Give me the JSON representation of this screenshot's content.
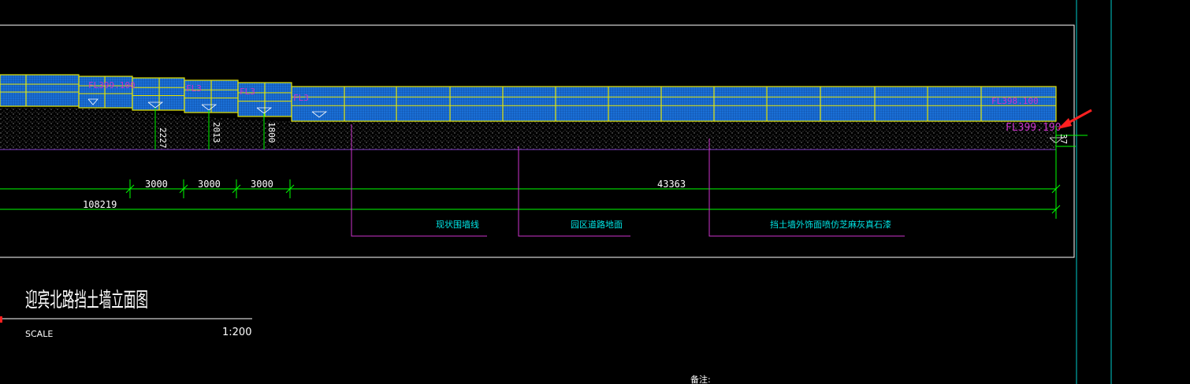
{
  "drawing": {
    "title": "迎宾北路挡土墙立面图",
    "scale_label": "SCALE",
    "scale_value": "1:200",
    "notes_label": "备注:"
  },
  "dimensions": {
    "segment_1": "3000",
    "segment_2": "3000",
    "segment_3": "3000",
    "main_span": "43363",
    "total_span": "108219",
    "height_1": "2227",
    "height_2": "2013",
    "height_3": "1800",
    "height_end": "37"
  },
  "leaders": {
    "existing_wall": "现状围墙线",
    "road_surface": "园区道路地面",
    "wall_finish": "挡土墙外饰面喷仿芝麻灰真石漆"
  },
  "elevations": {
    "label_1": "FL399.100",
    "label_2": "FL3",
    "label_3": "FL3",
    "label_4": "FL3",
    "label_end": "FL398.100",
    "label_end_ground": "FL399.190"
  },
  "colors": {
    "background": "#000000",
    "frame": "#ffffff",
    "wall_fill": "#1a6fd6",
    "wall_outline": "#e6e600",
    "dimension": "#00ff00",
    "leader": "#cc33cc",
    "leader_text": "#00e5e5",
    "elevation_text": "#cc33cc",
    "ground": "#9a9a9a",
    "grid_line": "#00cccc",
    "arrow": "#ff2020"
  }
}
